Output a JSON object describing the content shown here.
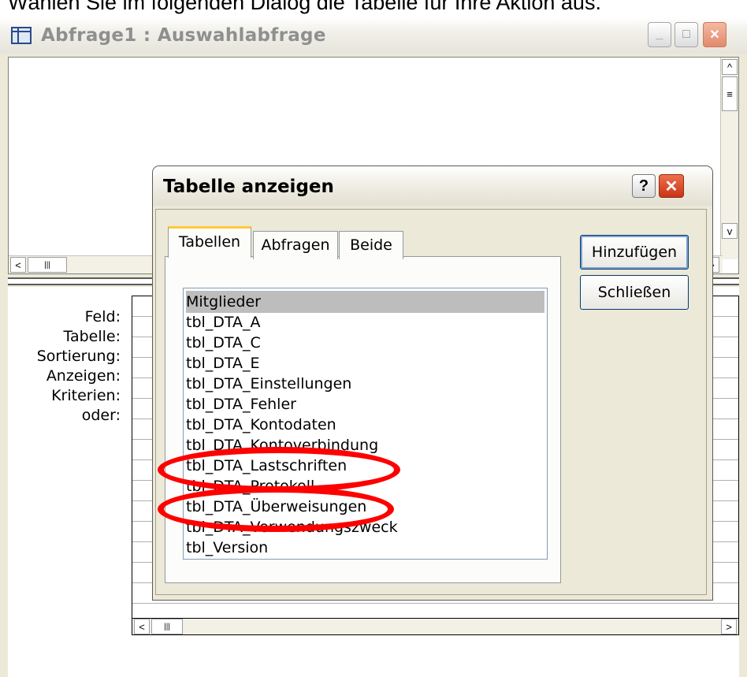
{
  "caption": "Wählen Sie im folgenden Dialog die Tabelle für Ihre Aktion aus.",
  "main_window": {
    "title": "Abfrage1 : Auswahlabfrage",
    "icon": "table-grid-icon",
    "min_label": "_",
    "max_label": "□",
    "close_label": "✕"
  },
  "upper_pane": {
    "scroll_up": "^",
    "scroll_down": "v",
    "scroll_left": "<",
    "scroll_right": ">",
    "thumb": "≡",
    "thumb_h": "|||"
  },
  "design_grid": {
    "row_labels": [
      "Feld:",
      "Tabelle:",
      "Sortierung:",
      "Anzeigen:",
      "Kriterien:",
      "oder:"
    ],
    "scroll_left": "<",
    "scroll_right": ">",
    "thumb_h": "|||"
  },
  "dialog": {
    "title": "Tabelle anzeigen",
    "help_label": "?",
    "close_label": "✕",
    "tabs": [
      {
        "label": "Tabellen",
        "active": true
      },
      {
        "label": "Abfragen",
        "active": false
      },
      {
        "label": "Beide",
        "active": false
      }
    ],
    "items": [
      "Mitglieder",
      "tbl_DTA_A",
      "tbl_DTA_C",
      "tbl_DTA_E",
      "tbl_DTA_Einstellungen",
      "tbl_DTA_Fehler",
      "tbl_DTA_Kontodaten",
      "tbl_DTA_Kontoverbindung",
      "tbl_DTA_Lastschriften",
      "tbl_DTA_Protokoll",
      "tbl_DTA_Überweisungen",
      "tbl_DTA_Verwendungszweck",
      "tbl_Version"
    ],
    "selected_item": "Mitglieder",
    "buttons": {
      "add": "Hinzufügen",
      "close": "Schließen"
    },
    "highlight_color": "#ff0000"
  }
}
